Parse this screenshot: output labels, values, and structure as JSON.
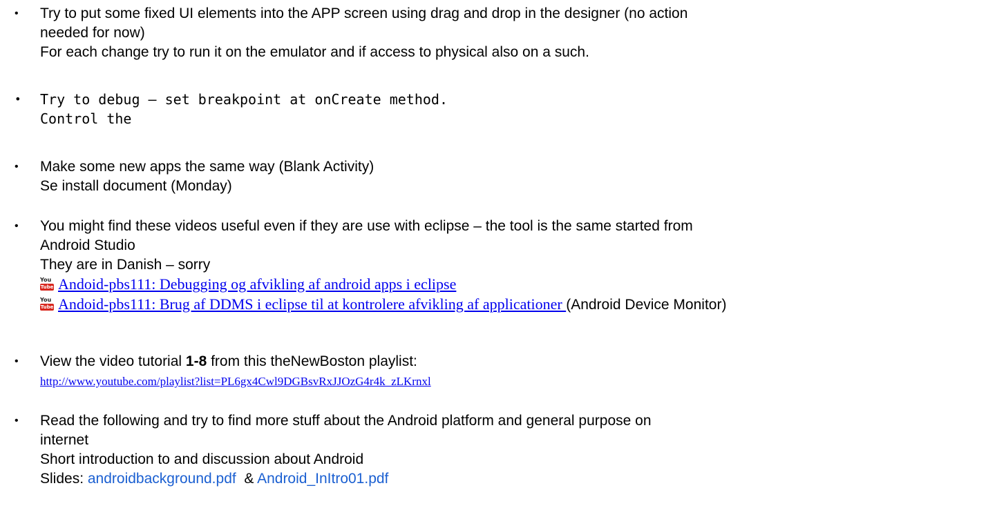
{
  "items": [
    {
      "lines": [
        "Try to put some fixed UI elements into the APP screen using drag and drop in the designer (no action",
        "needed for now)",
        "For each change try to run it on the emulator and if access to physical also on a such."
      ]
    },
    {
      "lines": [
        "Try to debug – set breakpoint at onCreate method.",
        "Control the"
      ]
    },
    {
      "lines": [
        "Make some new apps the same way (Blank Activity)",
        "Se install document (Monday)"
      ]
    },
    {
      "lines": [
        "You might find these videos useful even if they are use with eclipse – the tool is the same started from",
        "Android Studio",
        "They are in Danish – sorry"
      ],
      "links": [
        {
          "text": "Andoid-pbs111: Debugging og afvikling af android apps i eclipse",
          "icon": "youtube-icon"
        },
        {
          "text": "Andoid-pbs111: Brug af DDMS i eclipse til at kontrolere afvikling af applicationer ",
          "icon": "youtube-icon",
          "suffix": "(Android Device Monitor)"
        }
      ],
      "icon_text_top": "You",
      "icon_text_bottom": "Tube"
    },
    {
      "prefix": "View the video tutorial ",
      "bold": "1-8",
      "suffix": " from this theNewBoston playlist:",
      "url": "http://www.youtube.com/playlist?list=PL6gx4Cwl9DGBsvRxJJOzG4r4k_zLKrnxl"
    },
    {
      "lines": [
        "Read the following and try to find more stuff about the Android platform and general purpose on",
        "internet",
        "Short introduction to and discussion about Android"
      ],
      "slides_label": "Slides: ",
      "slide1": "androidbackground.pdf",
      "amp": "  & ",
      "slide2": "Android_InItro01.pdf"
    }
  ],
  "bullet_char": "•",
  "colors": {
    "link": "#0000ee",
    "slide_link": "#1a5fd1",
    "youtube_red": "#d8261d"
  }
}
